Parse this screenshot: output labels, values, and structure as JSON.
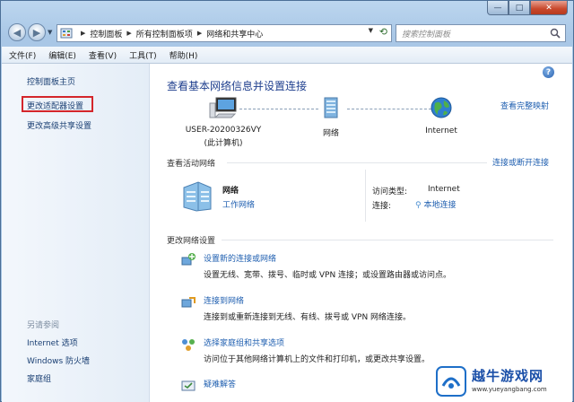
{
  "window": {
    "controls": {
      "min": "—",
      "max": "□",
      "close": "✕"
    }
  },
  "address": {
    "crumbs": [
      "控制面板",
      "所有控制面板项",
      "网络和共享中心"
    ]
  },
  "search": {
    "placeholder": "搜索控制面板"
  },
  "menu": [
    "文件(F)",
    "编辑(E)",
    "查看(V)",
    "工具(T)",
    "帮助(H)"
  ],
  "sidebar": {
    "home": "控制面板主页",
    "adapter": "更改适配器设置",
    "advanced": "更改高级共享设置",
    "see_also": "另请参阅",
    "links": [
      "Internet 选项",
      "Windows 防火墙",
      "家庭组"
    ]
  },
  "main": {
    "heading": "查看基本网络信息并设置连接",
    "full_map": "查看完整映射",
    "computer": {
      "name": "USER-20200326VY",
      "sub": "(此计算机)"
    },
    "network": "网络",
    "internet": "Internet",
    "active_label": "查看活动网络",
    "connect_link": "连接或断开连接",
    "active": {
      "name": "网络",
      "type": "工作网络",
      "access_label": "访问类型:",
      "access_value": "Internet",
      "conn_label": "连接:",
      "conn_value": "本地连接"
    },
    "change_label": "更改网络设置",
    "tasks": [
      {
        "title": "设置新的连接或网络",
        "desc": "设置无线、宽带、拨号、临时或 VPN 连接；或设置路由器或访问点。"
      },
      {
        "title": "连接到网络",
        "desc": "连接到或重新连接到无线、有线、拨号或 VPN 网络连接。"
      },
      {
        "title": "选择家庭组和共享选项",
        "desc": "访问位于其他网络计算机上的文件和打印机，或更改共享设置。"
      },
      {
        "title": "疑难解答",
        "desc": ""
      }
    ]
  },
  "watermark": {
    "text": "越牛游戏网",
    "url": "www.yueyangbang.com"
  },
  "colors": {
    "link": "#1f5fb0",
    "heading": "#1f3f8e",
    "highlight": "#d4262b"
  }
}
